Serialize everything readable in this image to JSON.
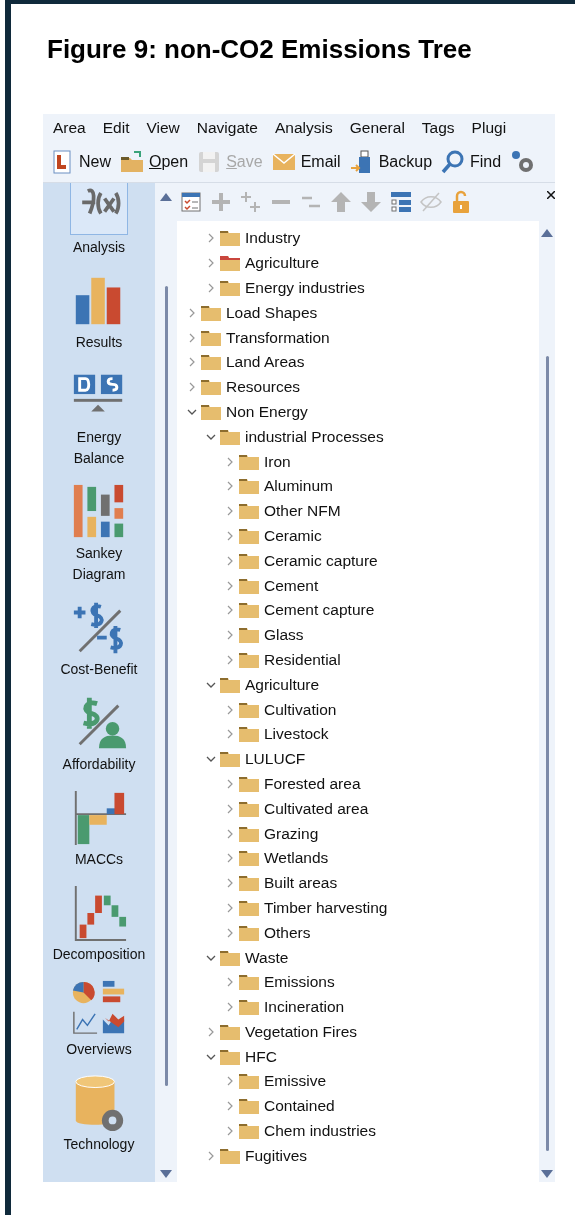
{
  "figure_title": "Figure 9: non-CO2 Emissions Tree",
  "menu": [
    "Area",
    "Edit",
    "View",
    "Navigate",
    "Analysis",
    "General",
    "Tags",
    "Plugi"
  ],
  "toolbar": [
    {
      "label": "New",
      "mnemonic": false,
      "disabled": false
    },
    {
      "label": "Open",
      "mnemonic": true,
      "disabled": false
    },
    {
      "label": "Save",
      "mnemonic": true,
      "disabled": true
    },
    {
      "label": "Email",
      "mnemonic": false,
      "disabled": false
    },
    {
      "label": "Backup",
      "mnemonic": false,
      "disabled": false
    },
    {
      "label": "Find",
      "mnemonic": false,
      "disabled": false
    }
  ],
  "sidebar": [
    {
      "label": "Analysis",
      "selected": true
    },
    {
      "label": "Results",
      "selected": false
    },
    {
      "label": "Energy\nBalance",
      "selected": false
    },
    {
      "label": "Sankey\nDiagram",
      "selected": false
    },
    {
      "label": "Cost-Benefit",
      "selected": false
    },
    {
      "label": "Affordability",
      "selected": false
    },
    {
      "label": "MACCs",
      "selected": false
    },
    {
      "label": "Decomposition",
      "selected": false
    },
    {
      "label": "Overviews",
      "selected": false
    },
    {
      "label": "Technology",
      "selected": false
    }
  ],
  "tree": [
    {
      "children": [
        {
          "label": "Industry",
          "expanded": false
        },
        {
          "label": "Agriculture",
          "expanded": false,
          "color": "#c9463d"
        },
        {
          "label": "Energy industries",
          "expanded": false
        }
      ]
    },
    {
      "label": "Load Shapes",
      "expanded": false
    },
    {
      "label": "Transformation",
      "expanded": false
    },
    {
      "label": "Land Areas",
      "expanded": false
    },
    {
      "label": "Resources",
      "expanded": false
    },
    {
      "label": "Non Energy",
      "expanded": true,
      "children": [
        {
          "label": "industrial Processes",
          "expanded": true,
          "children": [
            {
              "label": "Iron",
              "expanded": false
            },
            {
              "label": "Aluminum",
              "expanded": false
            },
            {
              "label": "Other NFM",
              "expanded": false
            },
            {
              "label": "Ceramic",
              "expanded": false
            },
            {
              "label": "Ceramic capture",
              "expanded": false
            },
            {
              "label": "Cement",
              "expanded": false
            },
            {
              "label": "Cement capture",
              "expanded": false
            },
            {
              "label": "Glass",
              "expanded": false
            },
            {
              "label": "Residential",
              "expanded": false
            }
          ]
        },
        {
          "label": "Agriculture",
          "expanded": true,
          "children": [
            {
              "label": "Cultivation",
              "expanded": false
            },
            {
              "label": "Livestock",
              "expanded": false
            }
          ]
        },
        {
          "label": "LULUCF",
          "expanded": true,
          "children": [
            {
              "label": "Forested area",
              "expanded": false
            },
            {
              "label": "Cultivated area",
              "expanded": false
            },
            {
              "label": "Grazing",
              "expanded": false
            },
            {
              "label": "Wetlands",
              "expanded": false
            },
            {
              "label": "Built areas",
              "expanded": false
            },
            {
              "label": "Timber harvesting",
              "expanded": false
            },
            {
              "label": "Others",
              "expanded": false
            }
          ]
        },
        {
          "label": "Waste",
          "expanded": true,
          "children": [
            {
              "label": "Emissions",
              "expanded": false
            },
            {
              "label": "Incineration",
              "expanded": false
            }
          ]
        },
        {
          "label": "Vegetation Fires",
          "expanded": false
        },
        {
          "label": "HFC",
          "expanded": true,
          "children": [
            {
              "label": "Emissive",
              "expanded": false
            },
            {
              "label": "Contained",
              "expanded": false
            },
            {
              "label": "Chem industries",
              "expanded": false
            }
          ]
        },
        {
          "label": "Fugitives",
          "expanded": false
        }
      ]
    }
  ]
}
